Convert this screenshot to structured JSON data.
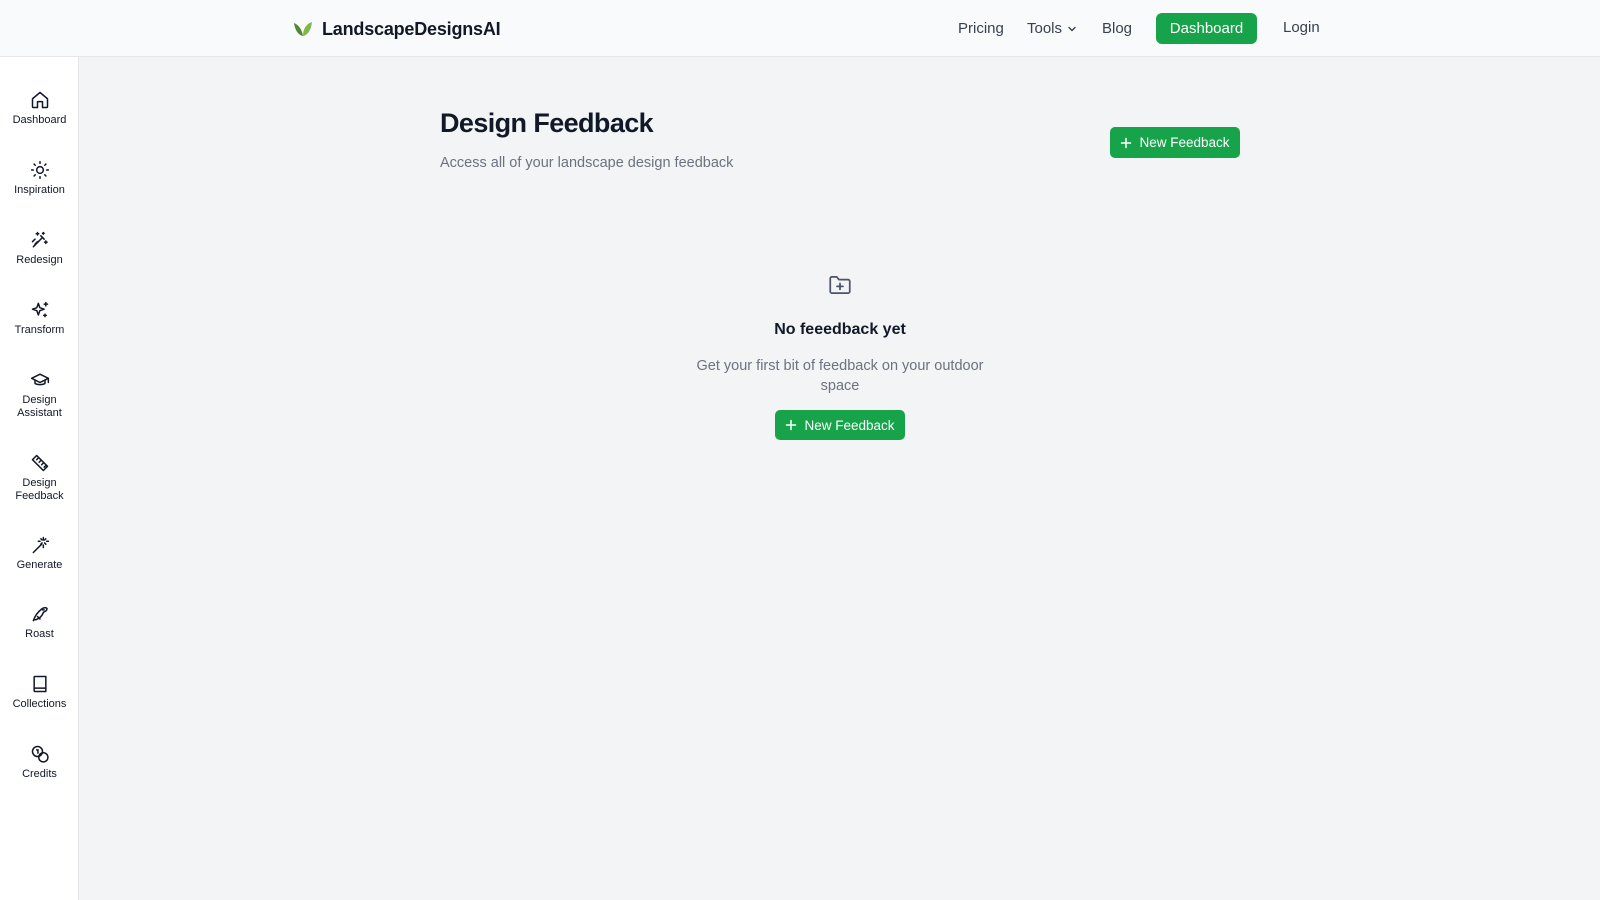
{
  "header": {
    "brand": "LandscapeDesignsAI",
    "nav": {
      "pricing": "Pricing",
      "tools": "Tools",
      "blog": "Blog",
      "dashboard": "Dashboard",
      "login": "Login"
    }
  },
  "sidebar": {
    "items": [
      {
        "label": "Dashboard",
        "icon": "home-icon"
      },
      {
        "label": "Inspiration",
        "icon": "sun-icon"
      },
      {
        "label": "Redesign",
        "icon": "magic-wand-icon"
      },
      {
        "label": "Transform",
        "icon": "sparkles-icon"
      },
      {
        "label": "Design Assistant",
        "icon": "graduation-cap-icon"
      },
      {
        "label": "Design Feedback",
        "icon": "ruler-icon"
      },
      {
        "label": "Generate",
        "icon": "wand-sparkle-icon"
      },
      {
        "label": "Roast",
        "icon": "bird-icon"
      },
      {
        "label": "Collections",
        "icon": "book-icon"
      },
      {
        "label": "Credits",
        "icon": "coins-icon"
      }
    ]
  },
  "main": {
    "title": "Design Feedback",
    "subtitle": "Access all of your landscape design feedback",
    "new_button": "New Feedback",
    "empty": {
      "title": "No feeedback yet",
      "text": "Get your first bit of feedback on your outdoor space",
      "button": "New Feedback"
    }
  },
  "colors": {
    "accent": "#16a34a",
    "background": "#f3f4f6",
    "muted_text": "#6b7280"
  }
}
